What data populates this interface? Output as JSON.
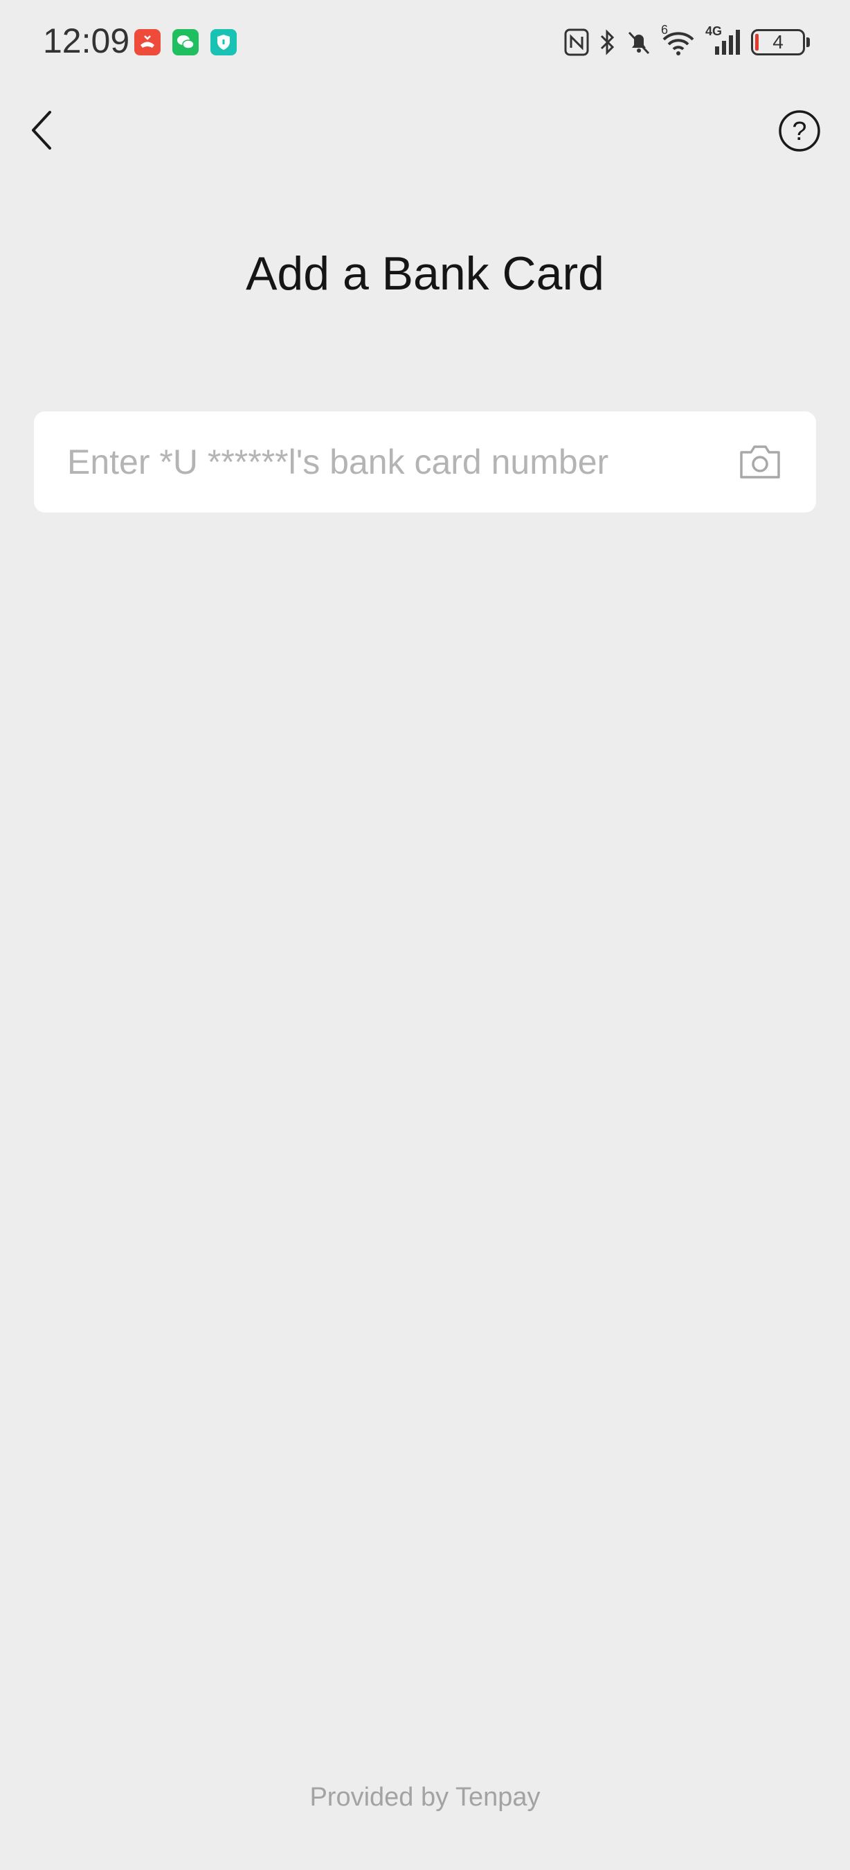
{
  "status_bar": {
    "time": "12:09",
    "battery_level": "4",
    "network": "4G",
    "wifi_badge": "6",
    "notification_icons": [
      "missed-call-icon",
      "wechat-icon",
      "security-shield-icon"
    ],
    "colors": {
      "missed_call": "#ee4b3a",
      "wechat": "#1fbf5f",
      "security": "#19c2b2",
      "battery_low": "#e23b2e"
    }
  },
  "nav": {
    "back_icon": "chevron-left-icon",
    "help_icon": "question-circle-icon",
    "help_glyph": "?"
  },
  "page": {
    "title": "Add a Bank Card"
  },
  "card_input": {
    "value": "",
    "placeholder": "Enter *U ******l's bank card number",
    "camera_icon": "camera-icon"
  },
  "footer": {
    "text": "Provided by Tenpay"
  }
}
